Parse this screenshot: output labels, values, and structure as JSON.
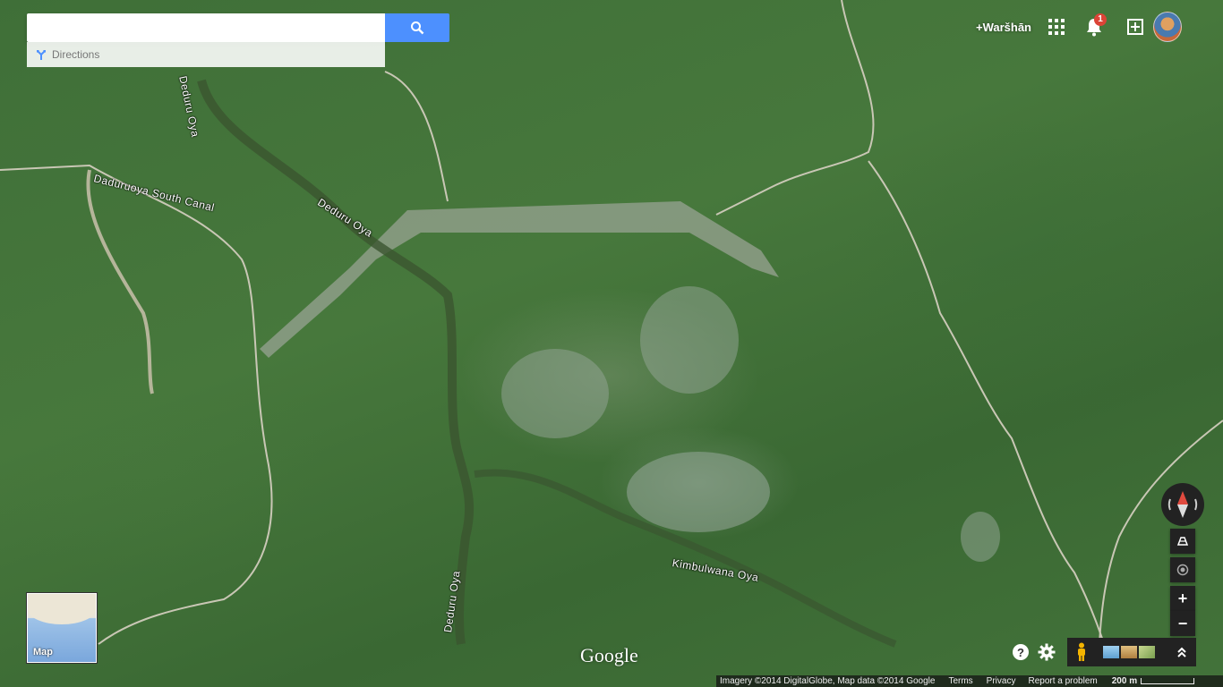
{
  "search": {
    "placeholder": "",
    "value": "",
    "button_icon": "search-icon",
    "directions_label": "Directions",
    "directions_icon": "directions-icon"
  },
  "topbar": {
    "user_name": "+Waršhān",
    "apps_icon": "apps-grid-icon",
    "notifications_icon": "bell-icon",
    "notification_count": "1",
    "share_icon": "add-box-icon",
    "avatar": "profile-avatar"
  },
  "map": {
    "labels": [
      {
        "text": "Deduru Oya"
      },
      {
        "text": "Daduruoya South Canal"
      },
      {
        "text": "Deduru Oya"
      },
      {
        "text": "Deduru Oya"
      },
      {
        "text": "Kimbulwana Oya"
      }
    ],
    "minimap_label": "Map",
    "logo_text": "Google"
  },
  "controls": {
    "compass_icon": "compass-icon",
    "tilt_icon": "tilt-icon",
    "my_location_icon": "my-location-icon",
    "zoom_in": "+",
    "zoom_out": "−",
    "help": "?",
    "settings_icon": "gear-icon",
    "pegman_icon": "pegman-icon",
    "expand_icon": "chevron-up-icon"
  },
  "footer": {
    "attribution": "Imagery ©2014 DigitalGlobe, Map data ©2014 Google",
    "terms": "Terms",
    "privacy": "Privacy",
    "report": "Report a problem",
    "scale": "200 m"
  },
  "colors": {
    "accent": "#4d90fe",
    "badge": "#db4437",
    "dark_control": "#222222"
  }
}
